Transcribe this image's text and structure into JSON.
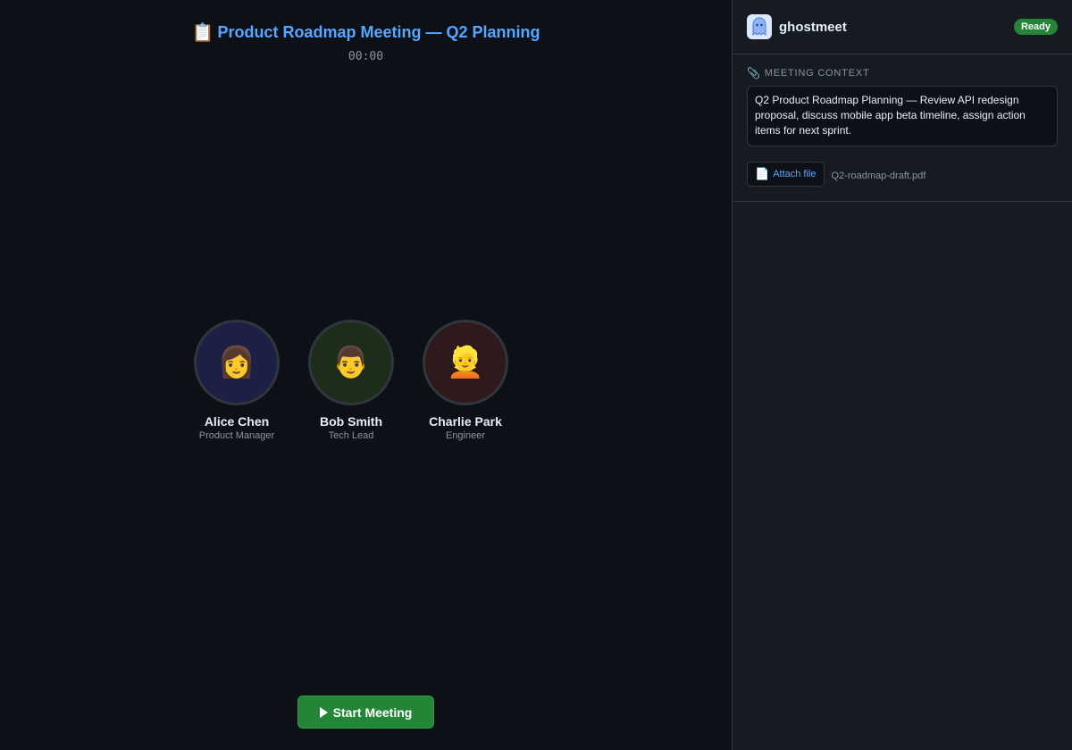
{
  "meeting": {
    "title_icon": "📋",
    "title": "Product Roadmap Meeting — Q2 Planning",
    "timer": "00:00",
    "start_button": "Start Meeting"
  },
  "participants": [
    {
      "name": "Alice Chen",
      "role": "Product Manager",
      "avatar": "👩",
      "avatar_bg": "#1c2045"
    },
    {
      "name": "Bob Smith",
      "role": "Tech Lead",
      "avatar": "👨",
      "avatar_bg": "#1c2e1a"
    },
    {
      "name": "Charlie Park",
      "role": "Engineer",
      "avatar": "👱",
      "avatar_bg": "#2e1a1a"
    }
  ],
  "panel": {
    "brand": "ghostmeet",
    "status": "Ready",
    "context_label_icon": "📎",
    "context_label": "Meeting Context",
    "context_text": "Q2 Product Roadmap Planning — Review API redesign proposal, discuss mobile app beta timeline, assign action items for next sprint.",
    "attach_icon": "📄",
    "attach_label": "Attach file",
    "attached_file": "Q2-roadmap-draft.pdf"
  },
  "colors": {
    "accent": "#58a6ff",
    "success": "#238636",
    "background": "#0d1117",
    "panel": "#161b22"
  }
}
